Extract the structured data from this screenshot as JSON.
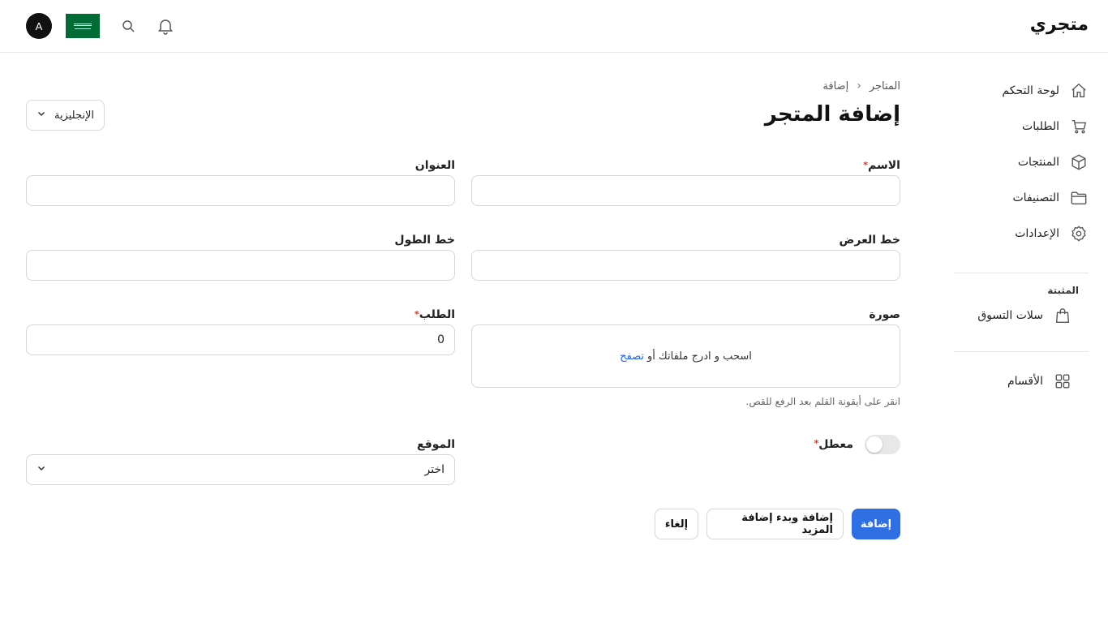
{
  "header": {
    "logo": "متجري",
    "avatar_letter": "A"
  },
  "sidebar": {
    "items": [
      {
        "label": "لوحة التحكم",
        "icon": "home-icon"
      },
      {
        "label": "الطلبات",
        "icon": "cart-icon"
      },
      {
        "label": "المنتجات",
        "icon": "box-icon"
      },
      {
        "label": "التصنيفات",
        "icon": "folder-icon"
      },
      {
        "label": "الإعدادات",
        "icon": "gear-icon"
      }
    ],
    "group_title": "المثبتة",
    "pinned": [
      {
        "label": "سلات التسوق",
        "icon": "bag-icon"
      }
    ],
    "sections": [
      {
        "label": "الأقسام",
        "icon": "grid-icon"
      }
    ]
  },
  "breadcrumb": {
    "root": "المتاجر",
    "current": "إضافة"
  },
  "page": {
    "title": "إضافة المتجر",
    "language_select": "الإنجليزية"
  },
  "form": {
    "name": {
      "label": "الاسم",
      "required": "*",
      "value": ""
    },
    "address": {
      "label": "العنوان",
      "value": ""
    },
    "latitude": {
      "label": "خط العرض",
      "value": ""
    },
    "longitude": {
      "label": "خط الطول",
      "value": ""
    },
    "image": {
      "label": "صورة",
      "drop_text": "اسحب و ادرج ملفاتك أو",
      "browse_text": "تصفح",
      "hint": "انقر على أيقونة القلم بعد الرفع للقص."
    },
    "order": {
      "label": "الطلب",
      "required": "*",
      "value": "0"
    },
    "disabled": {
      "label": "معطل",
      "required": "*",
      "on": false
    },
    "location": {
      "label": "الموقع",
      "placeholder": "اختر"
    }
  },
  "actions": {
    "add": "إضافة",
    "add_and_more": "إضافة وبدء إضافة المزيد",
    "cancel": "إلغاء"
  },
  "colors": {
    "primary": "#2f6fe4",
    "required": "#e0301e",
    "flag_green": "#006c35"
  }
}
